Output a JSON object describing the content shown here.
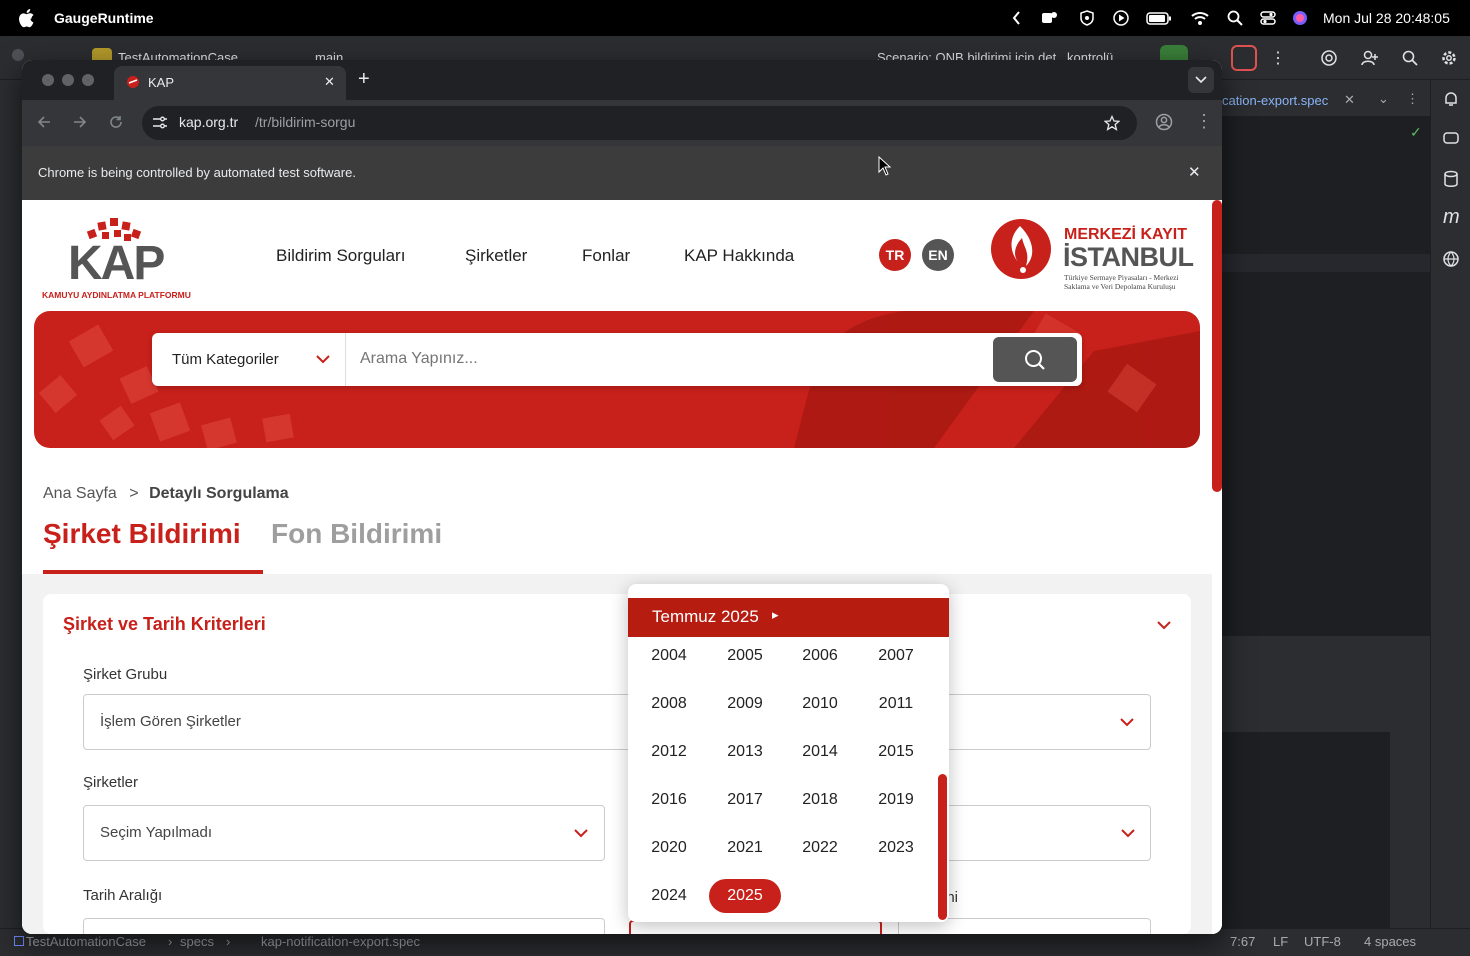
{
  "menubar": {
    "app_name": "GaugeRuntime",
    "clock": "Mon Jul 28  20:48:05"
  },
  "ide": {
    "project": "TestAutomationCase",
    "branch": "main",
    "run_config": "Scenario: QNB bildirimi için det...kontrolü",
    "editor_tab": "cation-export.spec",
    "status": {
      "path_root": "TestAutomationCase",
      "path_dir": "specs",
      "path_file": "kap-notification-export.spec",
      "position": "7:67",
      "line_sep": "LF",
      "encoding": "UTF-8",
      "indent": "4 spaces"
    }
  },
  "browser": {
    "tab_title": "KAP",
    "url_host": "kap.org.tr",
    "url_path": "/tr/bildirim-sorgu",
    "infobar_text": "Chrome is being controlled by automated test software."
  },
  "site": {
    "logo_text": "KAP",
    "logo_subtitle": "KAMUYU AYDINLATMA PLATFORMU",
    "nav": [
      "Bildirim Sorguları",
      "Şirketler",
      "Fonlar",
      "KAP Hakkında"
    ],
    "lang_tr": "TR",
    "lang_en": "EN",
    "mkk_line1": "MERKEZİ KAYIT",
    "mkk_line2": "İSTANBUL",
    "mkk_line3": "Türkiye Sermaye Piyasaları - Merkezi",
    "mkk_line4": "Saklama ve Veri Depolama Kuruluşu",
    "search": {
      "category": "Tüm Kategoriler",
      "placeholder": "Arama Yapınız..."
    },
    "breadcrumb": {
      "home": "Ana Sayfa",
      "sep": ">",
      "current": "Detaylı Sorgulama"
    },
    "tabs": {
      "company": "Şirket Bildirimi",
      "fund": "Fon Bildirimi"
    },
    "criteria": {
      "title": "Şirket ve Tarih Kriterleri",
      "group_label": "Şirket Grubu",
      "group_value": "İşlem Gören Şirketler",
      "companies_label": "Şirketler",
      "companies_value": "Seçim Yapılmadı",
      "date_range_label": "Tarih Aralığı",
      "date_label_partial": "rihi"
    },
    "year_picker": {
      "header": "Temmuz 2025",
      "arrow": "▸",
      "years": [
        "2004",
        "2005",
        "2006",
        "2007",
        "2008",
        "2009",
        "2010",
        "2011",
        "2012",
        "2013",
        "2014",
        "2015",
        "2016",
        "2017",
        "2018",
        "2019",
        "2020",
        "2021",
        "2022",
        "2023",
        "2024",
        "2025"
      ],
      "selected": "2025"
    }
  },
  "colors": {
    "brand_red": "#c8201a",
    "dark_red": "#b71c10",
    "gray_text": "#9e9e9e"
  }
}
